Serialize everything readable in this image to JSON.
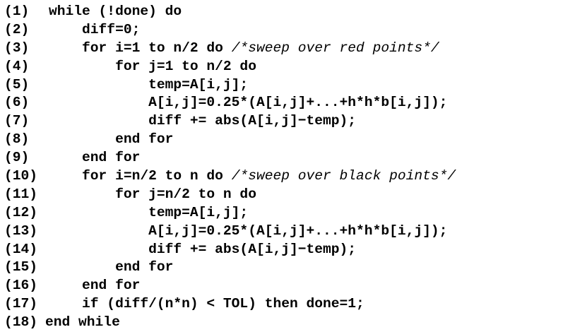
{
  "listing": {
    "lines": [
      {
        "num": "(1)",
        "indent": 1,
        "code": "while (!done) do",
        "comment": ""
      },
      {
        "num": "(2)",
        "indent": 2,
        "code": "diff=0;",
        "comment": ""
      },
      {
        "num": "(3)",
        "indent": 2,
        "code": "for i=1 to n/2 do ",
        "comment": "/*sweep over red points*/"
      },
      {
        "num": "(4)",
        "indent": 3,
        "code": "for j=1 to n/2 do",
        "comment": ""
      },
      {
        "num": "(5)",
        "indent": 4,
        "code": "temp=A[i,j];",
        "comment": ""
      },
      {
        "num": "(6)",
        "indent": 4,
        "code": "A[i,j]=0.25*(A[i,j]+...+h*h*b[i,j]);",
        "comment": ""
      },
      {
        "num": "(7)",
        "indent": 4,
        "code": "diff += abs(A[i,j]−temp);",
        "comment": ""
      },
      {
        "num": "(8)",
        "indent": 3,
        "code": "end for",
        "comment": ""
      },
      {
        "num": "(9)",
        "indent": 2,
        "code": "end for",
        "comment": ""
      },
      {
        "num": "(10)",
        "indent": 2,
        "code": "for i=n/2 to n do ",
        "comment": "/*sweep over black points*/"
      },
      {
        "num": "(11)",
        "indent": 3,
        "code": "for j=n/2 to n do",
        "comment": ""
      },
      {
        "num": "(12)",
        "indent": 4,
        "code": "temp=A[i,j];",
        "comment": ""
      },
      {
        "num": "(13)",
        "indent": 4,
        "code": "A[i,j]=0.25*(A[i,j]+...+h*h*b[i,j]);",
        "comment": ""
      },
      {
        "num": "(14)",
        "indent": 4,
        "code": "diff += abs(A[i,j]−temp);",
        "comment": ""
      },
      {
        "num": "(15)",
        "indent": 3,
        "code": "end for",
        "comment": ""
      },
      {
        "num": "(16)",
        "indent": 2,
        "code": "end for",
        "comment": ""
      },
      {
        "num": "(17)",
        "indent": 2,
        "code": "if (diff/(n*n) < TOL) then done=1;",
        "comment": ""
      },
      {
        "num": "(18)",
        "indent": 1,
        "code": "end while",
        "comment": ""
      }
    ]
  }
}
